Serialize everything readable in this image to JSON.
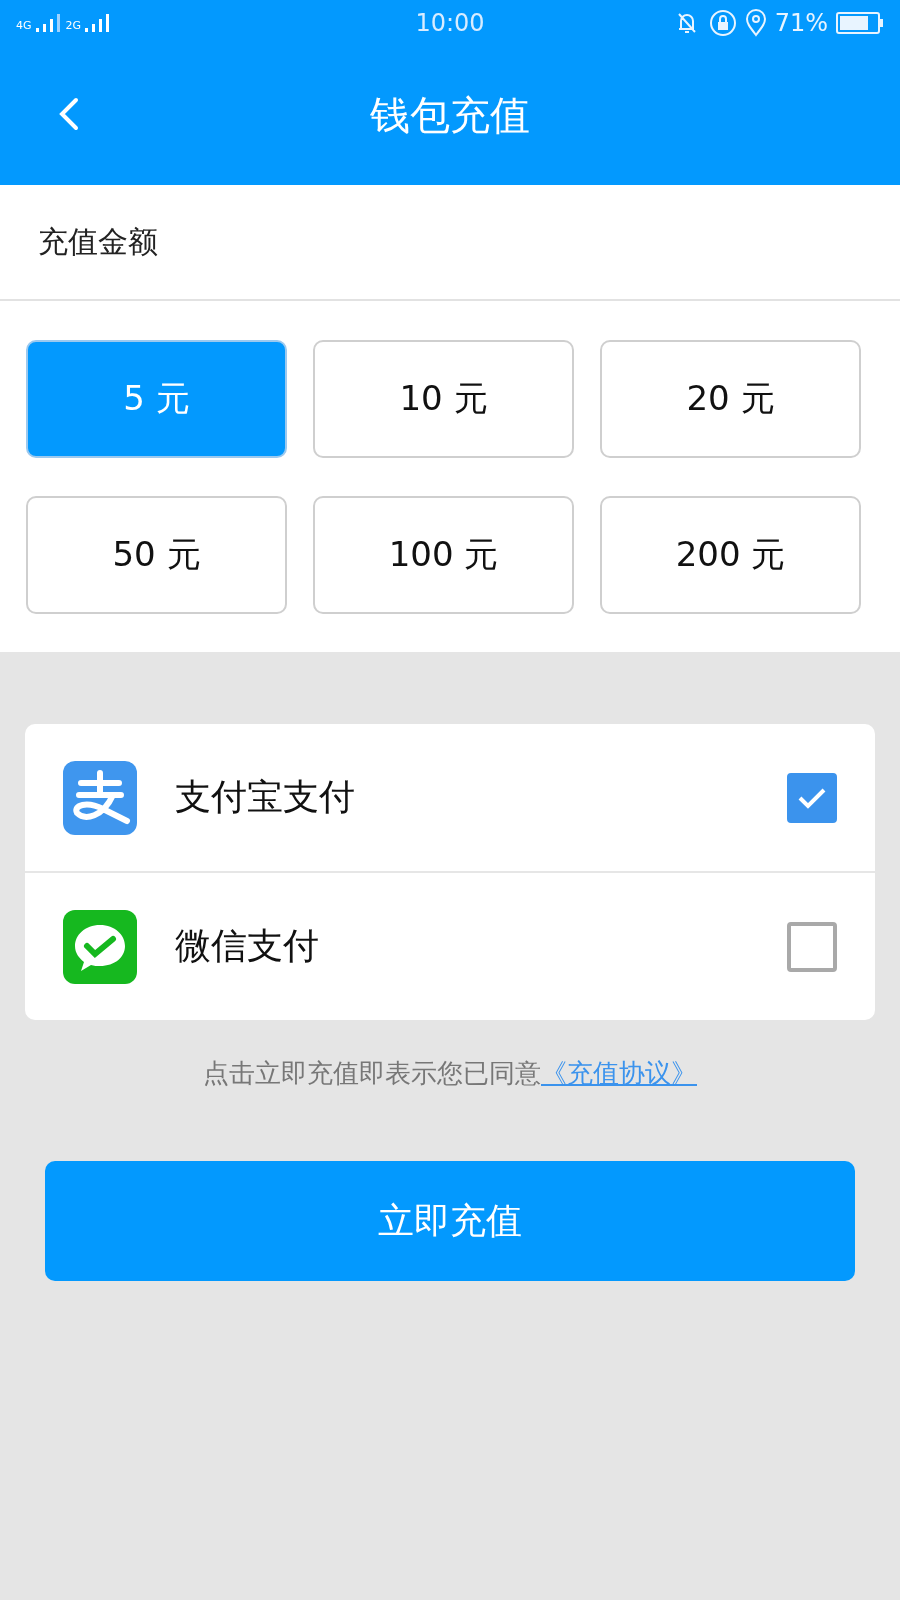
{
  "status_bar": {
    "network_1": "4G",
    "network_2": "2G",
    "time": "10:00",
    "battery": "71%"
  },
  "header": {
    "title": "钱包充值"
  },
  "amount_section": {
    "label": "充值金额",
    "options": [
      {
        "label": "5 元",
        "selected": true
      },
      {
        "label": "10 元",
        "selected": false
      },
      {
        "label": "20 元",
        "selected": false
      },
      {
        "label": "50 元",
        "selected": false
      },
      {
        "label": "100 元",
        "selected": false
      },
      {
        "label": "200 元",
        "selected": false
      }
    ]
  },
  "payment_methods": [
    {
      "kind": "alipay",
      "label": "支付宝支付",
      "checked": true
    },
    {
      "kind": "wechat",
      "label": "微信支付",
      "checked": false
    }
  ],
  "agreement": {
    "text": "点击立即充值即表示您已同意",
    "link": "《充值协议》"
  },
  "submit_button": "立即充值"
}
